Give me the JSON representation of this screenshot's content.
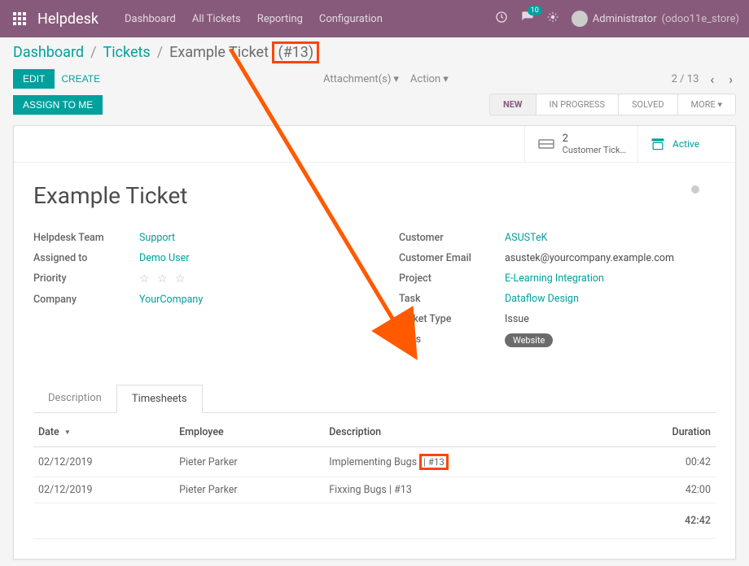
{
  "colors": {
    "primary": "#875a7b",
    "teal": "#00a09d",
    "highlight": "#ff4400"
  },
  "topbar": {
    "brand": "Helpdesk",
    "nav": [
      "Dashboard",
      "All Tickets",
      "Reporting",
      "Configuration"
    ],
    "msg_badge": "10",
    "user_name": "Administrator",
    "user_db": "(odoo11e_store)"
  },
  "breadcrumb": {
    "items": [
      "Dashboard",
      "Tickets"
    ],
    "current_pre": "Example Ticket",
    "current_highlight": "(#13)"
  },
  "btns": {
    "edit": "EDIT",
    "create": "CREATE",
    "assign": "ASSIGN TO ME",
    "attachments": "Attachment(s)",
    "action": "Action"
  },
  "pager": {
    "text": "2 / 13"
  },
  "status": {
    "items": [
      "NEW",
      "IN PROGRESS",
      "SOLVED"
    ],
    "more": "MORE",
    "active": "NEW"
  },
  "stats": {
    "tickets_count": "2",
    "tickets_label": "Customer Tick…",
    "active_label": "Active"
  },
  "ticket": {
    "title": "Example Ticket",
    "left": {
      "team_label": "Helpdesk Team",
      "team": "Support",
      "assigned_label": "Assigned to",
      "assigned": "Demo User",
      "priority_label": "Priority",
      "company_label": "Company",
      "company": "YourCompany"
    },
    "right": {
      "customer_label": "Customer",
      "customer": "ASUSTeK",
      "email_label": "Customer Email",
      "email": "asustek@yourcompany.example.com",
      "project_label": "Project",
      "project": "E-Learning Integration",
      "task_label": "Task",
      "task": "Dataflow Design",
      "type_label": "Ticket Type",
      "type": "Issue",
      "tags_label": "Tags",
      "tag": "Website"
    }
  },
  "tabs": {
    "description": "Description",
    "timesheets": "Timesheets"
  },
  "timesheets": {
    "head": {
      "date": "Date",
      "employee": "Employee",
      "description": "Description",
      "duration": "Duration"
    },
    "rows": [
      {
        "date": "02/12/2019",
        "employee": "Pieter Parker",
        "desc_pre": "Implementing Bugs ",
        "desc_hl": "| #13",
        "duration": "00:42"
      },
      {
        "date": "02/12/2019",
        "employee": "Pieter Parker",
        "desc_pre": "Fixxing Bugs | #13",
        "desc_hl": "",
        "duration": "42:00"
      }
    ],
    "total": "42:42"
  }
}
